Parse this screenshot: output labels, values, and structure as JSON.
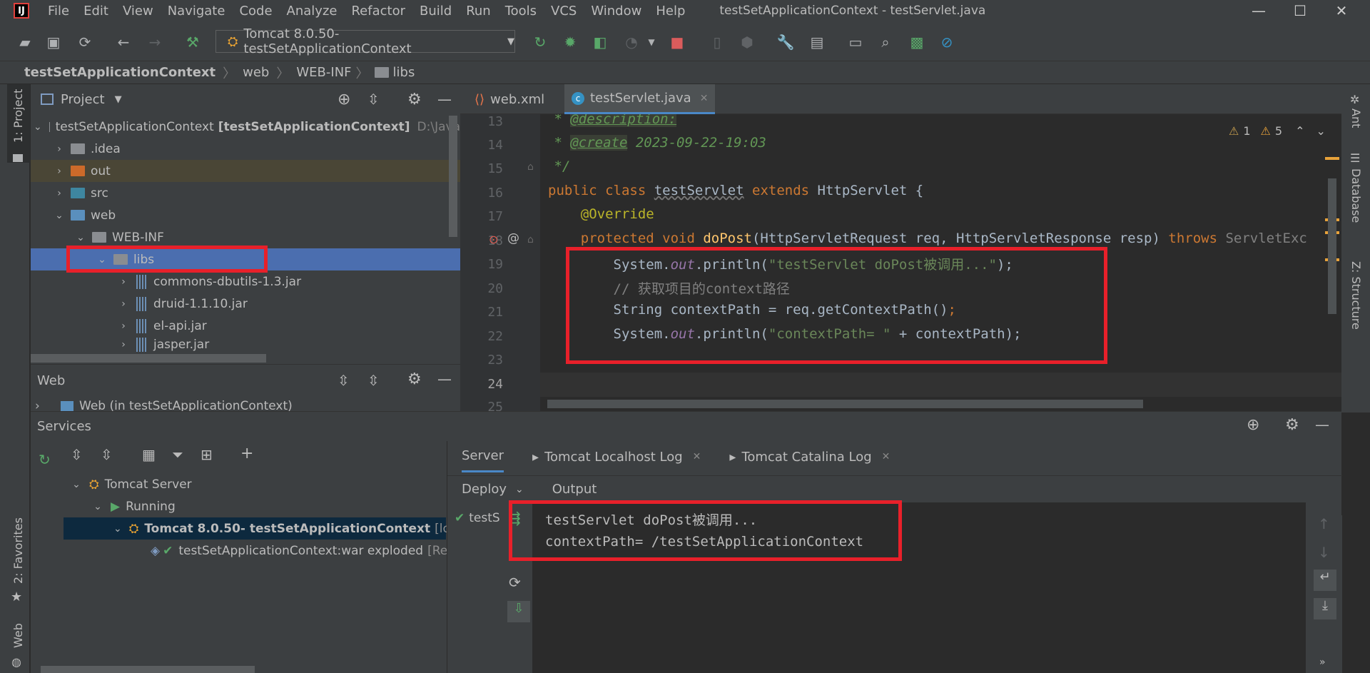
{
  "menu": {
    "items": [
      "File",
      "Edit",
      "View",
      "Navigate",
      "Code",
      "Analyze",
      "Refactor",
      "Build",
      "Run",
      "Tools",
      "VCS",
      "Window",
      "Help"
    ],
    "window_title": "testSetApplicationContext - testServlet.java"
  },
  "toolbar": {
    "run_config": "Tomcat 8.0.50- testSetApplicationContext"
  },
  "breadcrumb": [
    "testSetApplicationContext",
    "web",
    "WEB-INF",
    "libs"
  ],
  "left_stripe": {
    "project": "1: Project",
    "favorites": "2: Favorites",
    "web": "Web"
  },
  "right_stripe": {
    "ant": "Ant",
    "database": "Database",
    "structure": "Z: Structure"
  },
  "project_panel": {
    "title": "Project",
    "root_name": "testSetApplicationContext",
    "root_module": "[testSetApplicationContext]",
    "root_path": "D:\\Java",
    "items": [
      ".idea",
      "out",
      "src",
      "web",
      "WEB-INF",
      "libs",
      "commons-dbutils-1.3.jar",
      "druid-1.1.10.jar",
      "el-api.jar",
      "jasper.jar"
    ]
  },
  "web_panel": {
    "title": "Web",
    "item": "Web (in testSetApplicationContext)"
  },
  "editor": {
    "tabs": [
      "web.xml",
      "testServlet.java"
    ],
    "warnings": {
      "weak": "1",
      "warn": "5"
    },
    "line_numbers": [
      "13",
      "14",
      "15",
      "16",
      "17",
      "18",
      "19",
      "20",
      "21",
      "22",
      "23",
      "24",
      "25"
    ],
    "lines": {
      "l13_star": " * ",
      "l13_tag": "@description:",
      "l14_star": " * ",
      "l14_tag": "@create",
      "l14_text": " 2023-09-22-19:03",
      "l15": " */",
      "l16_kw1": "public class ",
      "l16_name": "testServlet",
      "l16_kw2": " extends ",
      "l16_rest": "HttpServlet {",
      "l17": "    @Override",
      "l18_kw": "    protected void ",
      "l18_fn": "doPost",
      "l18_params": "(HttpServletRequest req, HttpServletResponse resp) ",
      "l18_throws": "throws ",
      "l18_exc": "ServletExc",
      "l19_a": "        System.",
      "l19_out": "out",
      "l19_b": ".println(",
      "l19_str": "\"testServlet doPost被调用...\"",
      "l19_c": ");",
      "l20": "        // 获取项目的context路径",
      "l21_a": "        String contextPath = req.getContextPath()",
      "l21_semi": ";",
      "l22_a": "        System.",
      "l22_out": "out",
      "l22_b": ".println(",
      "l22_str": "\"contextPath= \"",
      "l22_c": " + contextPath);"
    }
  },
  "services": {
    "title": "Services",
    "tree": {
      "server": "Tomcat Server",
      "running": "Running",
      "instance": "Tomcat 8.0.50- testSetApplicationContext",
      "instance_suffix": "[local]",
      "artifact": "testSetApplicationContext:war exploded",
      "artifact_suffix": "[Re"
    },
    "tabs": [
      "Server",
      "Tomcat Localhost Log",
      "Tomcat Catalina Log"
    ],
    "deploy_label": "Deploy",
    "output_label": "Output",
    "deploy_item": "testS",
    "output_lines": [
      "testServlet doPost被调用...",
      "contextPath= /testSetApplicationContext"
    ]
  },
  "colors": {
    "highlight_box": "#e8202a",
    "selection": "#4b6eaf"
  }
}
